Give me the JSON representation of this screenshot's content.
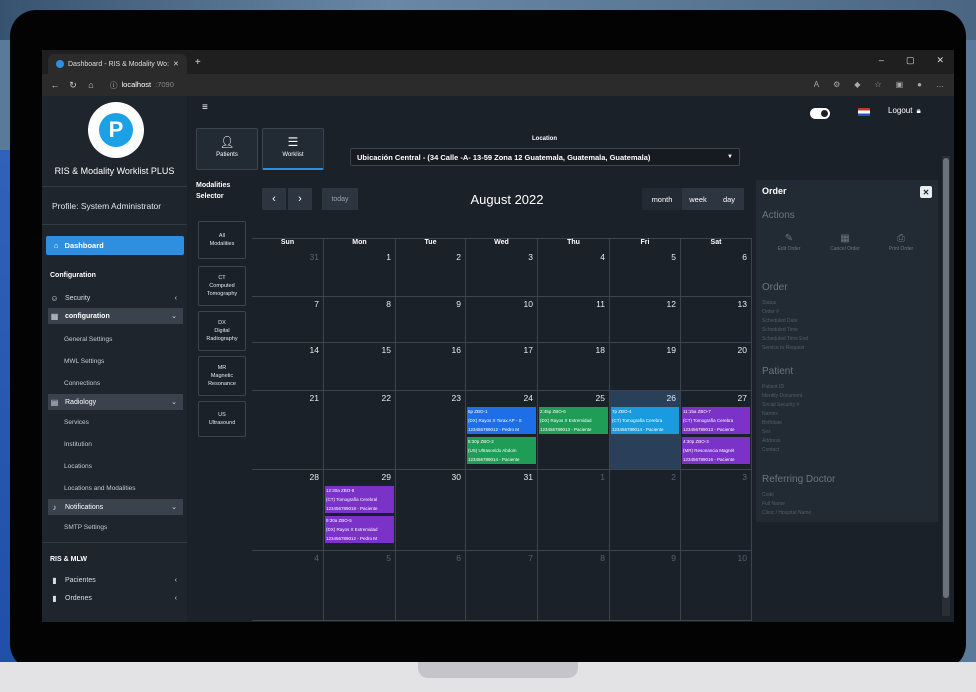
{
  "browser": {
    "tab_title": "Dashboard - RIS & Modality Wo:",
    "url_host": "localhost",
    "url_port": ":7090"
  },
  "sidebar": {
    "app_name": "RIS & Modality Worklist PLUS",
    "profile": "Profile: System Administrator",
    "dashboard": "Dashboard",
    "configuration_heading": "Configuration",
    "security": "Security",
    "configuration": "configuration",
    "general_settings": "General Settings",
    "mwl_settings": "MWL Settings",
    "connections": "Connections",
    "radiology": "Radiology",
    "services": "Services",
    "institution": "Institution",
    "locations": "Locations",
    "locations_modalities": "Locations and Modalities",
    "notifications": "Notifications",
    "smtp_settings": "SMTP Settings",
    "ris_heading": "RIS & MLW",
    "pacientes": "Pacientes",
    "ordenes": "Ordenes"
  },
  "header": {
    "logout": "Logout",
    "patients": "Patients",
    "worklist": "Worklist",
    "location_label": "Location",
    "location_value": "Ubicación Central - (34 Calle -A- 13-59 Zona 12 Guatemala, Guatemala, Guatemala)"
  },
  "modalities": {
    "heading_1": "Modalities",
    "heading_2": "Selector",
    "items": [
      {
        "line1": "All",
        "line2": "Modalities",
        "line3": ""
      },
      {
        "line1": "CT",
        "line2": "Computed",
        "line3": "Tomography"
      },
      {
        "line1": "DX",
        "line2": "Digital",
        "line3": "Radiography"
      },
      {
        "line1": "MR",
        "line2": "Magnetic",
        "line3": "Resonance"
      },
      {
        "line1": "US",
        "line2": "Ultrasound",
        "line3": ""
      }
    ]
  },
  "calendar": {
    "title": "August 2022",
    "today": "today",
    "month": "month",
    "week": "week",
    "day": "day",
    "weekdays": [
      "Sun",
      "Mon",
      "Tue",
      "Wed",
      "Thu",
      "Fri",
      "Sat"
    ],
    "weeks": [
      [
        "31",
        "1",
        "2",
        "3",
        "4",
        "5",
        "6"
      ],
      [
        "7",
        "8",
        "9",
        "10",
        "11",
        "12",
        "13"
      ],
      [
        "14",
        "15",
        "16",
        "17",
        "18",
        "19",
        "20"
      ],
      [
        "21",
        "22",
        "23",
        "24",
        "25",
        "26",
        "27"
      ],
      [
        "28",
        "29",
        "30",
        "31",
        "1",
        "2",
        "3"
      ],
      [
        "4",
        "5",
        "6",
        "7",
        "8",
        "9",
        "10"
      ]
    ],
    "events": [
      {
        "week": 3,
        "day": 3,
        "slot": 0,
        "color": "#1e6ee8",
        "l1": "5p ZBO-1",
        "l2": "(DX) Rayos X Torax AP - S",
        "l3": "123456789012 - Pedro M"
      },
      {
        "week": 3,
        "day": 3,
        "slot": 1,
        "color": "#1f9c55",
        "l1": "5:30p ZBO-2",
        "l2": "(US) Ultrasonido Abdom",
        "l3": "123456789014 - Paciente"
      },
      {
        "week": 3,
        "day": 4,
        "slot": 0,
        "color": "#1f9c55",
        "l1": "2:45p ZBO-6",
        "l2": "(DX) Rayos X Extremidad",
        "l3": "123456789013 - Paciente"
      },
      {
        "week": 3,
        "day": 5,
        "slot": 0,
        "color": "#1a9be0",
        "l1": "7p ZBO-4",
        "l2": "(CT) Tomografía Cerebra",
        "l3": "123456789014 - Paciente"
      },
      {
        "week": 3,
        "day": 6,
        "slot": 0,
        "color": "#7a32c8",
        "l1": "11:15a ZBO-7",
        "l2": "(CT) Tomografía Cerebra",
        "l3": "123456789013 - Paciente"
      },
      {
        "week": 3,
        "day": 6,
        "slot": 1,
        "color": "#7a32c8",
        "l1": "4:30p ZBO-3",
        "l2": "(MR) Resonancia Magnét",
        "l3": "123456789016 - Paciente"
      },
      {
        "week": 4,
        "day": 1,
        "slot": 0,
        "color": "#7a32c8",
        "l1": "12:30a ZBO-8",
        "l2": "(CT) Tomografía Cerebral",
        "l3": "123456789018 - Paciente"
      },
      {
        "week": 4,
        "day": 1,
        "slot": 1,
        "color": "#7a32c8",
        "l1": "9:30a ZBO-5",
        "l2": "(DX) Rayos X Extremidad",
        "l3": "123456789012 - Pedro M"
      }
    ]
  },
  "order": {
    "title": "Order",
    "actions": "Actions",
    "edit": "Edit Order",
    "cancel": "Cancel Order",
    "print": "Print Order",
    "order_heading": "Order",
    "order_fields": [
      "Status",
      "Order #",
      "Scheduled Date",
      "Scheduled Time",
      "Scheduled Time End",
      "Service to Request"
    ],
    "patient_heading": "Patient",
    "patient_fields": [
      "Patient ID",
      "Identity Document",
      "Social Security #",
      "Names",
      "Birthdate",
      "Sex",
      "Address",
      "Contact"
    ],
    "doctor_heading": "Referring Doctor",
    "doctor_fields": [
      "Code",
      "Full Name",
      "Clinic / Hospital Name"
    ]
  }
}
